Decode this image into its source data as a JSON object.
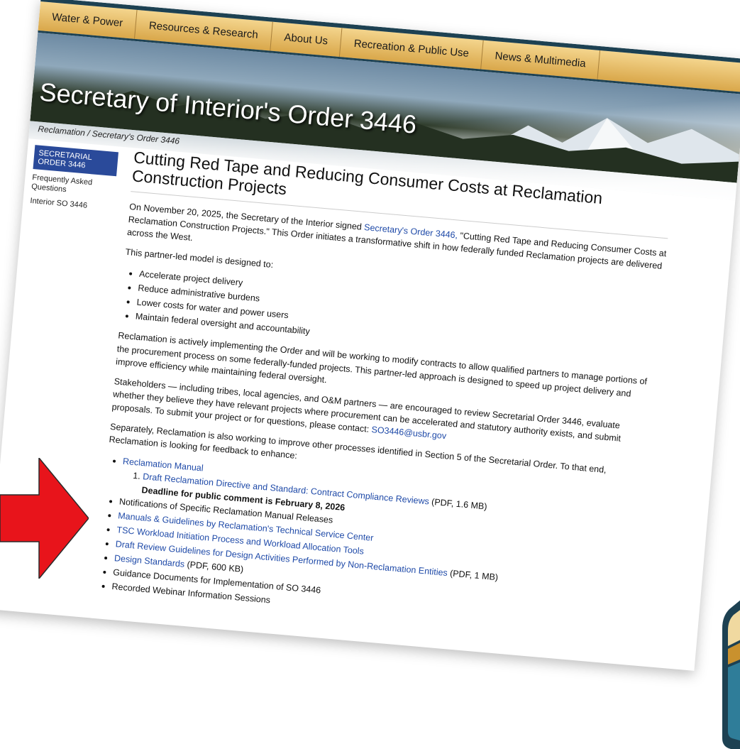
{
  "nav": [
    "Water & Power",
    "Resources & Research",
    "About Us",
    "Recreation & Public Use",
    "News & Multimedia"
  ],
  "banner": {
    "title": "Secretary of Interior's Order 3446"
  },
  "breadcrumb": "Reclamation / Secretary's Order 3446",
  "sidebar": {
    "active": "SECRETARIAL ORDER 3446",
    "links": [
      "Frequently Asked Questions",
      "Interior SO 3446"
    ]
  },
  "content": {
    "title": "Cutting Red Tape and Reducing Consumer Costs at Reclamation Construction Projects",
    "p1_pre": "On November 20, 2025, the Secretary of the Interior signed ",
    "p1_link": "Secretary's Order 3446,",
    "p1_post": " \"Cutting Red Tape and Reducing Consumer Costs at Reclamation Construction Projects.\" This Order initiates a transformative shift in how federally funded Reclamation projects are delivered across the West.",
    "p2": "This partner-led model is designed to:",
    "goals": [
      "Accelerate project delivery",
      "Reduce administrative burdens",
      "Lower costs for water and power users",
      "Maintain federal oversight and accountability"
    ],
    "p3": "Reclamation is actively implementing the Order and will be working to modify contracts to allow qualified partners to manage portions of the procurement process on some federally-funded projects. This partner-led approach is designed to speed up project delivery and improve efficiency while maintaining federal oversight.",
    "p4_pre": "Stakeholders — including tribes, local agencies, and O&M partners — are encouraged to review Secretarial Order 3446, evaluate whether they believe they have relevant projects where procurement can be accelerated and statutory authority exists, and submit proposals. To submit your project or for questions, please contact: ",
    "p4_email": "SO3446@usbr.gov",
    "p5": "Separately, Reclamation is also working to improve other processes identified in Section 5 of the Secretarial Order. To that end, Reclamation is looking for feedback to enhance:",
    "manual_link": "Reclamation Manual",
    "draft_link": "Draft Reclamation Directive and Standard: Contract Compliance Reviews",
    "draft_size": " (PDF, 1.6 MB)",
    "deadline": "Deadline for public comment is February 8, 2026",
    "items": [
      {
        "text": "Notifications of Specific Reclamation Manual Releases",
        "link": false,
        "suffix": ""
      },
      {
        "text": "Manuals & Guidelines by Reclamation's Technical Service Center",
        "link": true,
        "suffix": ""
      },
      {
        "text": "TSC Workload Initiation Process and Workload Allocation Tools",
        "link": true,
        "suffix": ""
      },
      {
        "text": "Draft Review Guidelines for Design Activities Performed by Non-Reclamation Entities",
        "link": true,
        "suffix": " (PDF, 1 MB)"
      },
      {
        "text": "Design Standards",
        "link": true,
        "suffix": " (PDF, 600 KB)"
      },
      {
        "text": "Guidance Documents for Implementation of SO 3446",
        "link": false,
        "suffix": ""
      },
      {
        "text": "Recorded Webinar Information Sessions",
        "link": false,
        "suffix": ""
      }
    ]
  },
  "colors": {
    "arrow": "#e8141b",
    "nav_gold": "#e0b35a",
    "link": "#1f4aa8",
    "sidebar_active": "#2a4a9a"
  }
}
